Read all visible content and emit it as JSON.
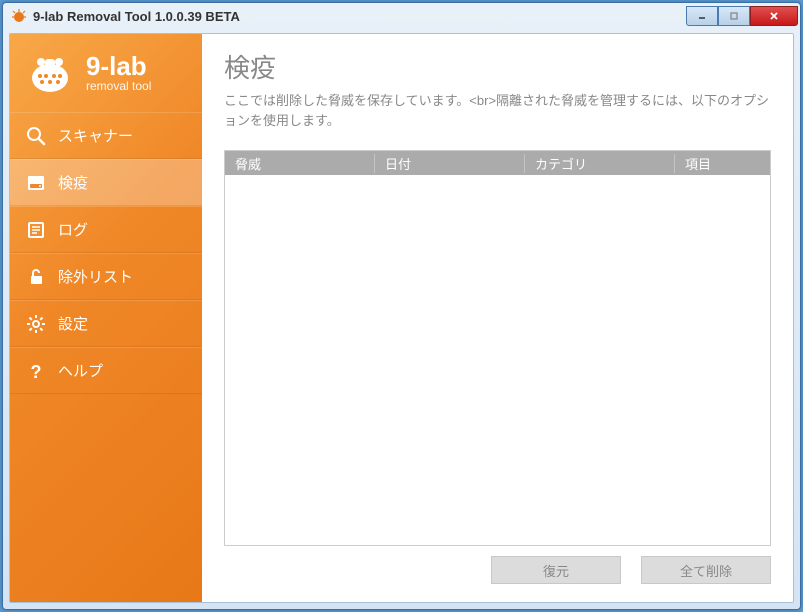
{
  "window": {
    "title": "9-lab Removal Tool 1.0.0.39 BETA"
  },
  "logo": {
    "brand": "9-lab",
    "subtitle": "removal tool"
  },
  "sidebar": {
    "items": [
      {
        "label": "スキャナー"
      },
      {
        "label": "検疫"
      },
      {
        "label": "ログ"
      },
      {
        "label": "除外リスト"
      },
      {
        "label": "設定"
      },
      {
        "label": "ヘルプ"
      }
    ]
  },
  "content": {
    "title": "検疫",
    "description": "ここでは削除した脅威を保存しています。<br>隔離された脅威を管理するには、以下のオプションを使用します。"
  },
  "table": {
    "headers": {
      "threat": "脅威",
      "date": "日付",
      "category": "カテゴリ",
      "item": "項目"
    }
  },
  "buttons": {
    "restore": "復元",
    "delete_all": "全て削除"
  }
}
